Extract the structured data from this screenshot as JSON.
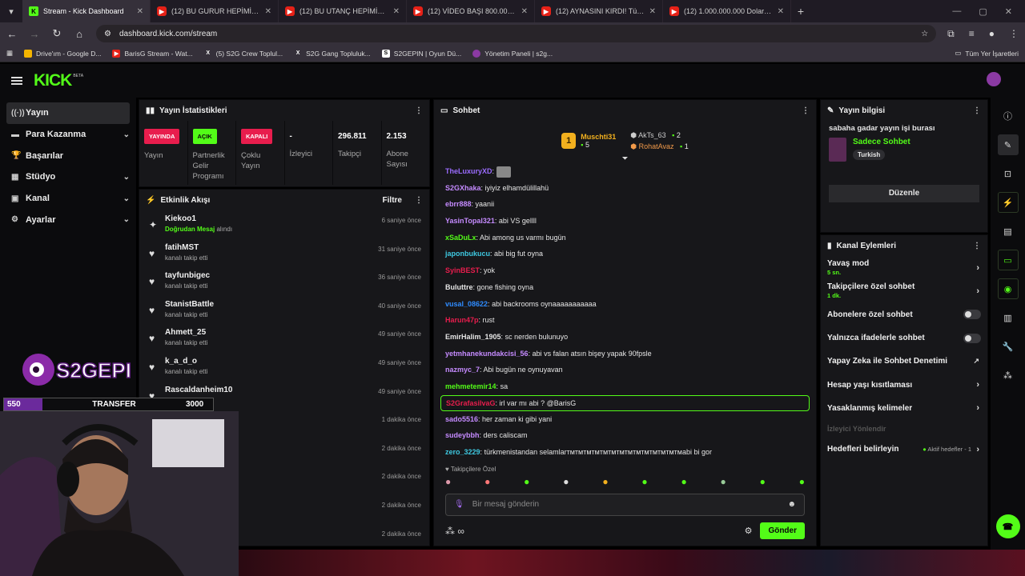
{
  "browser": {
    "tabs": [
      {
        "label": "Stream - Kick Dashboard",
        "icon": "kick-icon",
        "active": true
      },
      {
        "label": "(12) BU GURUR HEPİMİZİN | M",
        "icon": "youtube-icon"
      },
      {
        "label": "(12) BU UTANÇ HEPİMİZİN | M",
        "icon": "youtube-icon"
      },
      {
        "label": "(12) VİDEO BAŞI 800.000 TL DU",
        "icon": "youtube-icon"
      },
      {
        "label": "(12) AYNASINI KIRDI! Türkiye'd",
        "icon": "youtube-icon"
      },
      {
        "label": "(12) 1.000.000.000 Dolarlık Çiki",
        "icon": "youtube-icon"
      }
    ],
    "url": "dashboard.kick.com/stream",
    "bookmarks": [
      {
        "label": "Drive'ım - Google D..."
      },
      {
        "label": "BarisG Stream - Wat..."
      },
      {
        "label": "(5) S2G Crew Toplul..."
      },
      {
        "label": "S2G Gang Topluluk..."
      },
      {
        "label": "S2GEPIN | Oyun Dü..."
      },
      {
        "label": "Yönetim Paneli | s2g..."
      }
    ],
    "all_bookmarks": "Tüm Yer İşaretleri"
  },
  "kick": {
    "logo": "KICK",
    "beta": "BETA",
    "sidebar": [
      {
        "label": "Yayın",
        "icon": "broadcast-icon",
        "active": true
      },
      {
        "label": "Para Kazanma",
        "icon": "money-icon",
        "chevron": true
      },
      {
        "label": "Başarılar",
        "icon": "trophy-icon"
      },
      {
        "label": "Stüdyo",
        "icon": "studio-icon",
        "chevron": true
      },
      {
        "label": "Kanal",
        "icon": "channel-icon",
        "chevron": true
      },
      {
        "label": "Ayarlar",
        "icon": "gear-icon",
        "chevron": true
      }
    ]
  },
  "stats": {
    "title": "Yayın İstatistikleri",
    "items": [
      {
        "badge": "YAYINDA",
        "color": "#e81d4d",
        "label": "Yayın"
      },
      {
        "badge": "AÇIK",
        "color": "#53fc18",
        "label": "Partnerlik Gelir Programı"
      },
      {
        "badge": "KAPALI",
        "color": "#e81d4d",
        "label": "Çoklu Yayın"
      },
      {
        "value": "-",
        "label": "İzleyici"
      },
      {
        "value": "296.811",
        "label": "Takipçi"
      },
      {
        "value": "2.153",
        "label": "Abone Sayısı"
      }
    ]
  },
  "activity": {
    "title": "Etkinlik Akışı",
    "filter": "Filtre",
    "events": [
      {
        "user": "Kiekoo1",
        "action": "alındı",
        "gift": "Doğrudan Mesaj",
        "time": "6 saniye önce"
      },
      {
        "user": "fatihMST",
        "action": "kanalı takip etti",
        "time": "31 saniye önce"
      },
      {
        "user": "tayfunbigec",
        "action": "kanalı takip etti",
        "time": "36 saniye önce"
      },
      {
        "user": "StanistBattle",
        "action": "kanalı takip etti",
        "time": "40 saniye önce"
      },
      {
        "user": "Ahmett_25",
        "action": "kanalı takip etti",
        "time": "49 saniye önce"
      },
      {
        "user": "k_a_d_o",
        "action": "kanalı takip etti",
        "time": "49 saniye önce"
      },
      {
        "user": "Rascaldanheim10",
        "action": "kanalı takip etti",
        "time": "49 saniye önce"
      },
      {
        "user": "",
        "action": "",
        "time": "1 dakika önce"
      },
      {
        "user": "",
        "action": "",
        "time": "2 dakika önce"
      },
      {
        "user": "",
        "action": "",
        "time": "2 dakika önce"
      },
      {
        "user": "",
        "action": "",
        "time": "2 dakika önce"
      },
      {
        "user": "",
        "action": "",
        "time": "2 dakika önce"
      }
    ]
  },
  "chat": {
    "title": "Sohbet",
    "top_gifter": {
      "name": "Muschti31",
      "count": "5",
      "rank": "1"
    },
    "gifters": [
      {
        "name": "AkTs_63",
        "count": "2"
      },
      {
        "name": "RohatAvaz",
        "count": "1"
      }
    ],
    "messages": [
      {
        "user": "TheLuxuryXD",
        "color": "#9b6cff",
        "text": ""
      },
      {
        "user": "S2GXhaka",
        "color": "#c58bff",
        "text": "iyiyiz elhamdülillahü"
      },
      {
        "user": "ebrr888",
        "color": "#c58bff",
        "text": "yaanii"
      },
      {
        "user": "YasinTopal321",
        "color": "#c58bff",
        "text": "abi VS gellll"
      },
      {
        "user": "xSaDuLx",
        "color": "#53fc18",
        "text": "Abi among us varmı bugün"
      },
      {
        "user": "japonbukucu",
        "color": "#3ec8e0",
        "text": "abi big fut oyna"
      },
      {
        "user": "SyinBEST",
        "color": "#e81d4d",
        "text": "yok"
      },
      {
        "user": "Buluttre",
        "color": "#e6e6e6",
        "text": "gone fishing oyna"
      },
      {
        "user": "vusal_08622",
        "color": "#2f8cff",
        "text": "abi backrooms oynaaaaaaaaaaa"
      },
      {
        "user": "Harun47p",
        "color": "#e81d4d",
        "text": "rust"
      },
      {
        "user": "EmirHalim_1905",
        "color": "#e6e6e6",
        "text": "sc nerden bulunuyo"
      },
      {
        "user": "yetmhanekundakcisi_56",
        "color": "#c58bff",
        "text": "abi vs falan atsın bişey yapak 90fpsle"
      },
      {
        "user": "nazmyc_7",
        "color": "#c58bff",
        "text": "Abi bugün ne oynuyavan"
      },
      {
        "user": "mehmetemir14",
        "color": "#53fc18",
        "text": "sa"
      },
      {
        "user": "S2GrafasilvaG",
        "color": "#e81d4d",
        "text": "irl var mı abi ? @BarisG",
        "highlight": true
      },
      {
        "user": "sado5516",
        "color": "#c58bff",
        "text": "her zaman ki gibi yani"
      },
      {
        "user": "sudeybbh",
        "color": "#c58bff",
        "text": "ders caliscam"
      },
      {
        "user": "zero_3229",
        "color": "#3ec8e0",
        "text": "türkmenistandan selamlarт​м​т​м​т​м​т​м​т​м​т​м​т​м​т​м​т​м​т​м​т​м​т​м​т​м​т​м​abi bi gor"
      }
    ],
    "followers_only": "Takipçilere Özel",
    "placeholder": "Bir mesaj gönderin",
    "send": "Gönder"
  },
  "stream_info": {
    "title": "Yayın bilgisi",
    "stream_title": "sabaha gadar yayın işi burası",
    "category": "Sadece Sohbet",
    "tag": "Turkish",
    "edit": "Düzenle"
  },
  "channel_actions": {
    "title": "Kanal Eylemleri",
    "items": [
      {
        "label": "Yavaş mod",
        "sub": "5 sn.",
        "kind": "chevron"
      },
      {
        "label": "Takipçilere özel sohbet",
        "sub": "1 dk.",
        "kind": "chevron"
      },
      {
        "label": "Abonelere özel sohbet",
        "kind": "toggle"
      },
      {
        "label": "Yalnızca ifadelerle sohbet",
        "kind": "toggle"
      },
      {
        "label": "Yapay Zeka ile Sohbet Denetimi",
        "kind": "external"
      },
      {
        "label": "Hesap yaşı kısıtlaması",
        "kind": "chevron"
      },
      {
        "label": "Yasaklanmış kelimeler",
        "kind": "chevron"
      },
      {
        "label": "İzleyici Yönlendir",
        "kind": "disabled"
      },
      {
        "label": "Hedefleri belirleyin",
        "sub_right": "Aktif hedefler - 1",
        "kind": "chevron"
      }
    ]
  },
  "overlay": {
    "brand": "S2GEPIN",
    "left_value": "550",
    "center": "TRANSFER",
    "right_value": "3000"
  }
}
